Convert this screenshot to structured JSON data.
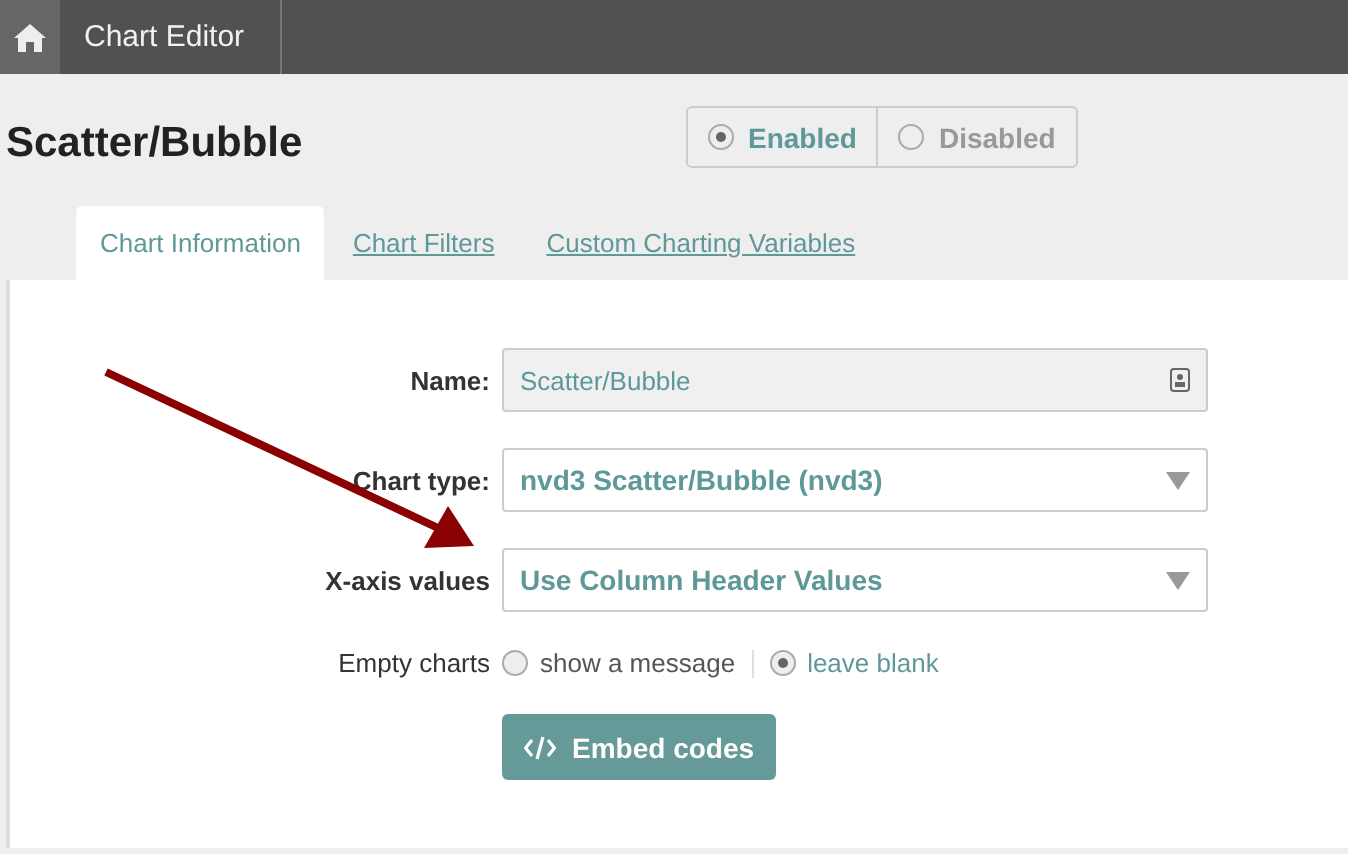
{
  "breadcrumb": {
    "items": [
      "Chart Editor"
    ]
  },
  "title": "Scatter/Bubble",
  "status_toggle": [
    {
      "label": "Enabled",
      "selected": true
    },
    {
      "label": "Disabled",
      "selected": false
    }
  ],
  "tabs": [
    {
      "label": "Chart Information",
      "selected": true
    },
    {
      "label": "Chart Filters",
      "selected": false
    },
    {
      "label": "Custom Charting Variables",
      "selected": false
    }
  ],
  "form": {
    "name": {
      "label": "Name:",
      "value": "Scatter/Bubble",
      "disabled": true
    },
    "chart_type": {
      "label": "Chart type:",
      "value": "nvd3 Scatter/Bubble (nvd3)"
    },
    "x_axis": {
      "label": "X-axis values",
      "value": "Use Column Header Values"
    },
    "empty_charts": {
      "label": "Empty charts",
      "options": [
        {
          "label": "show a message",
          "selected": false
        },
        {
          "label": "leave blank",
          "selected": true
        }
      ]
    },
    "embed_button": "Embed codes"
  }
}
